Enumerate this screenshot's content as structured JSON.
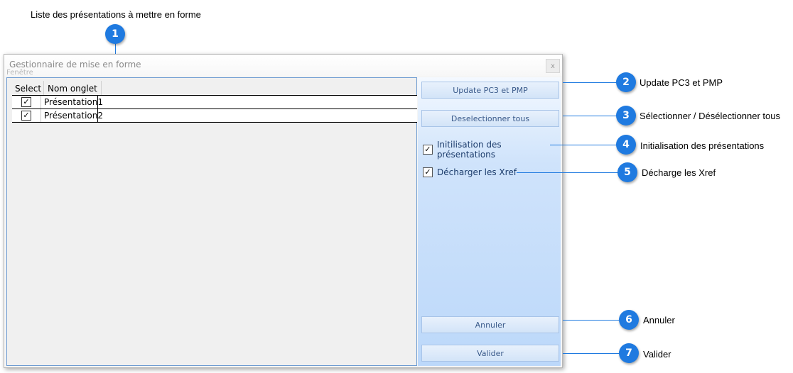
{
  "annotations": {
    "top_label": "Liste des présentations à mettre en forme",
    "items": [
      {
        "num": "1"
      },
      {
        "num": "2",
        "text": "Update PC3 et PMP"
      },
      {
        "num": "3",
        "text": "Sélectionner / Désélectionner tous"
      },
      {
        "num": "4",
        "text": "Initialisation des présentations"
      },
      {
        "num": "5",
        "text": "Décharge les Xref"
      },
      {
        "num": "6",
        "text": "Annuler"
      },
      {
        "num": "7",
        "text": "Valider"
      }
    ]
  },
  "window": {
    "title": "Gestionnaire de mise en forme",
    "subtitle": "Fenêtre",
    "close": "x"
  },
  "grid": {
    "columns": [
      "Select",
      "Nom onglet"
    ],
    "rows": [
      {
        "selected": "✓",
        "name": "Présentation1"
      },
      {
        "selected": "✓",
        "name": "Présentation2"
      }
    ]
  },
  "actions": {
    "update": "Update PC3 et PMP",
    "deselect": "Deselectionner tous",
    "init_label": "Initilisation des présentations",
    "init_checked": "✓",
    "xref_label": "Décharger les Xref",
    "xref_checked": "✓",
    "cancel": "Annuler",
    "ok": "Valider"
  },
  "colors": {
    "accent": "#1f7ae0",
    "panel_border": "#6d9bd1",
    "button_text": "#3a5a8a"
  }
}
